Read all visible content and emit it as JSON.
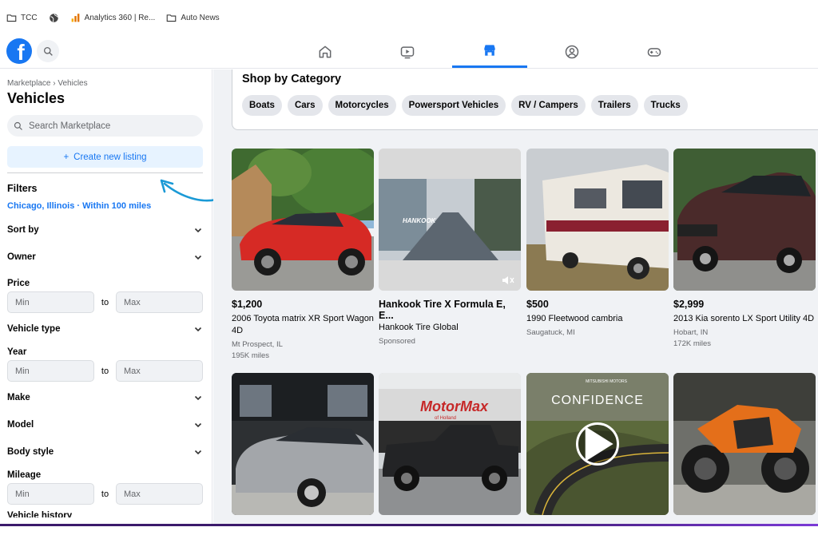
{
  "bookmarks": [
    {
      "label": "TCC",
      "icon": "folder-icon"
    },
    {
      "label": "",
      "icon": "globe-icon"
    },
    {
      "label": "Analytics 360 | Re...",
      "icon": "analytics-icon"
    },
    {
      "label": "Auto News",
      "icon": "folder-icon"
    }
  ],
  "nav": {
    "tabs": [
      "home-icon",
      "video-icon",
      "marketplace-icon",
      "groups-icon",
      "gaming-icon"
    ],
    "active_tab": "marketplace-icon",
    "accent": "#1877f2"
  },
  "sidebar": {
    "breadcrumb": "Marketplace › Vehicles",
    "title": "Vehicles",
    "search_placeholder": "Search Marketplace",
    "create_label": "Create new listing",
    "filters_heading": "Filters",
    "location": "Chicago, Illinois · Within 100 miles",
    "sort_by": "Sort by",
    "owner": "Owner",
    "price_label": "Price",
    "price_min": "Min",
    "price_max": "Max",
    "to": "to",
    "vehicle_type": "Vehicle type",
    "year_label": "Year",
    "year_min": "Min",
    "year_max": "Max",
    "make": "Make",
    "model": "Model",
    "body_style": "Body style",
    "mileage_label": "Mileage",
    "mileage_min": "Min",
    "mileage_max": "Max",
    "vehicle_history": "Vehicle history"
  },
  "category": {
    "title": "Shop by Category",
    "chips": [
      "Boats",
      "Cars",
      "Motorcycles",
      "Powersport Vehicles",
      "RV / Campers",
      "Trailers",
      "Trucks"
    ]
  },
  "listings": [
    {
      "price": "$1,200",
      "title": "2006 Toyota matrix XR Sport Wagon 4D",
      "location": "Mt Prospect, IL",
      "mileage": "195K miles"
    },
    {
      "price": "",
      "title": "Hankook Tire X Formula E, E...",
      "location": "Hankook Tire Global",
      "mileage": "Sponsored"
    },
    {
      "price": "$500",
      "title": "1990 Fleetwood cambria",
      "location": "Saugatuck, MI",
      "mileage": ""
    },
    {
      "price": "$2,999",
      "title": "2013 Kia sorento LX Sport Utility 4D",
      "location": "Hobart, IN",
      "mileage": "172K miles"
    }
  ],
  "image_text": {
    "hankook": "HANKOOK",
    "motormax": "MotorMax",
    "motormax_sub": "of Holland",
    "confidence": "CONFIDENCE",
    "mitsubishi": "MITSUBISHI MOTORS"
  }
}
